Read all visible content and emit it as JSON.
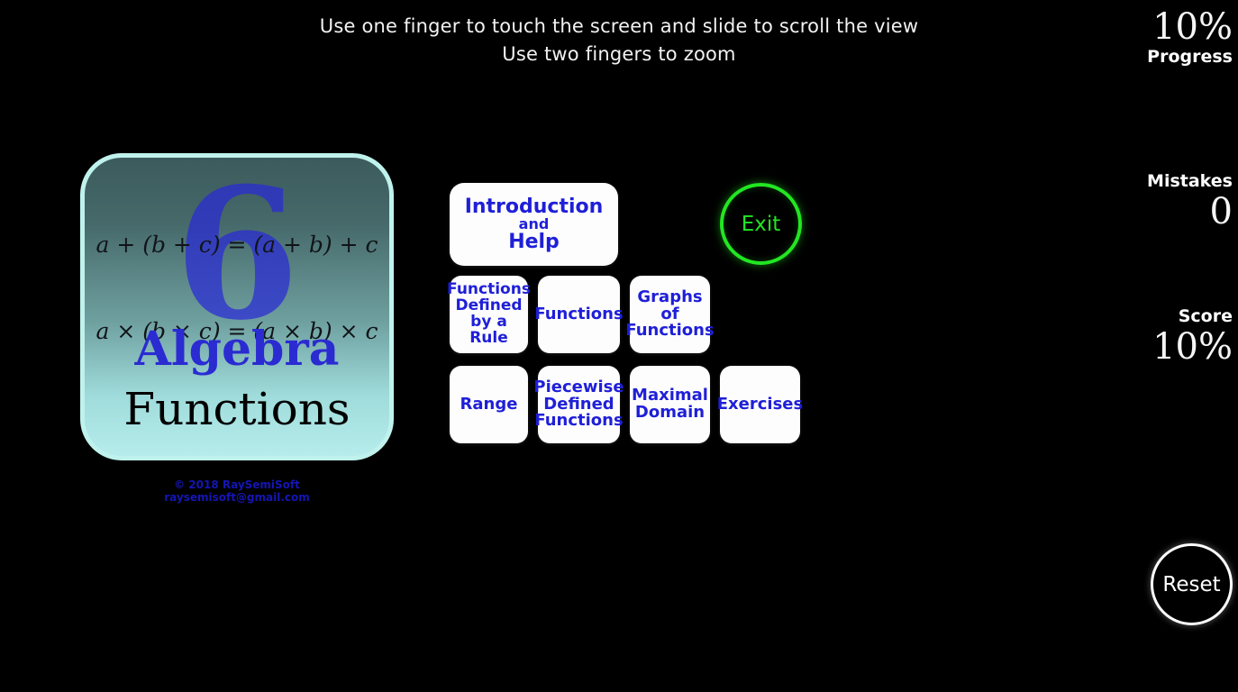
{
  "instructions": {
    "line1": "Use one finger to touch the screen and slide to scroll the view",
    "line2": "Use two fingers to zoom"
  },
  "status": {
    "progress": {
      "value": "10%",
      "label": "Progress"
    },
    "mistakes": {
      "label": "Mistakes",
      "value": "0"
    },
    "score": {
      "label": "Score",
      "value": "10%"
    }
  },
  "cover": {
    "number": "6",
    "formula_1": "a + (b + c) = (a + b) + c",
    "formula_2": "a × (b × c) = (a × b) × c",
    "subject": "Algebra",
    "topic": "Functions",
    "copyright_line1": "© 2018 RaySemiSoft",
    "copyright_line2": "raysemisoft@gmail.com"
  },
  "menu": {
    "intro_help": {
      "line1": "Introduction",
      "line2": "and",
      "line3": "Help"
    },
    "functions_rule": {
      "line1": "Functions",
      "line2": "Defined",
      "line3": "by a",
      "line4": "Rule"
    },
    "functions": {
      "line1": "Functions"
    },
    "graphs_of_functions": {
      "line1": "Graphs",
      "line2": "of",
      "line3": "Functions"
    },
    "range": {
      "line1": "Range"
    },
    "piecewise": {
      "line1": "Piecewise",
      "line2": "Defined",
      "line3": "Functions"
    },
    "maximal_domain": {
      "line1": "Maximal",
      "line2": "Domain"
    },
    "exercises": {
      "line1": "Exercises"
    }
  },
  "actions": {
    "exit": "Exit",
    "reset": "Reset"
  },
  "colors": {
    "background": "#000000",
    "button_text": "#1f1fd8",
    "button_face": "#fdfdfd",
    "exit_green": "#22e622",
    "reset_white": "#ffffff",
    "cover_border": "#bff2ec",
    "cover_top": "#3c5b5d",
    "cover_bottom": "#b6ecec",
    "copyright_blue": "#1515b4"
  }
}
